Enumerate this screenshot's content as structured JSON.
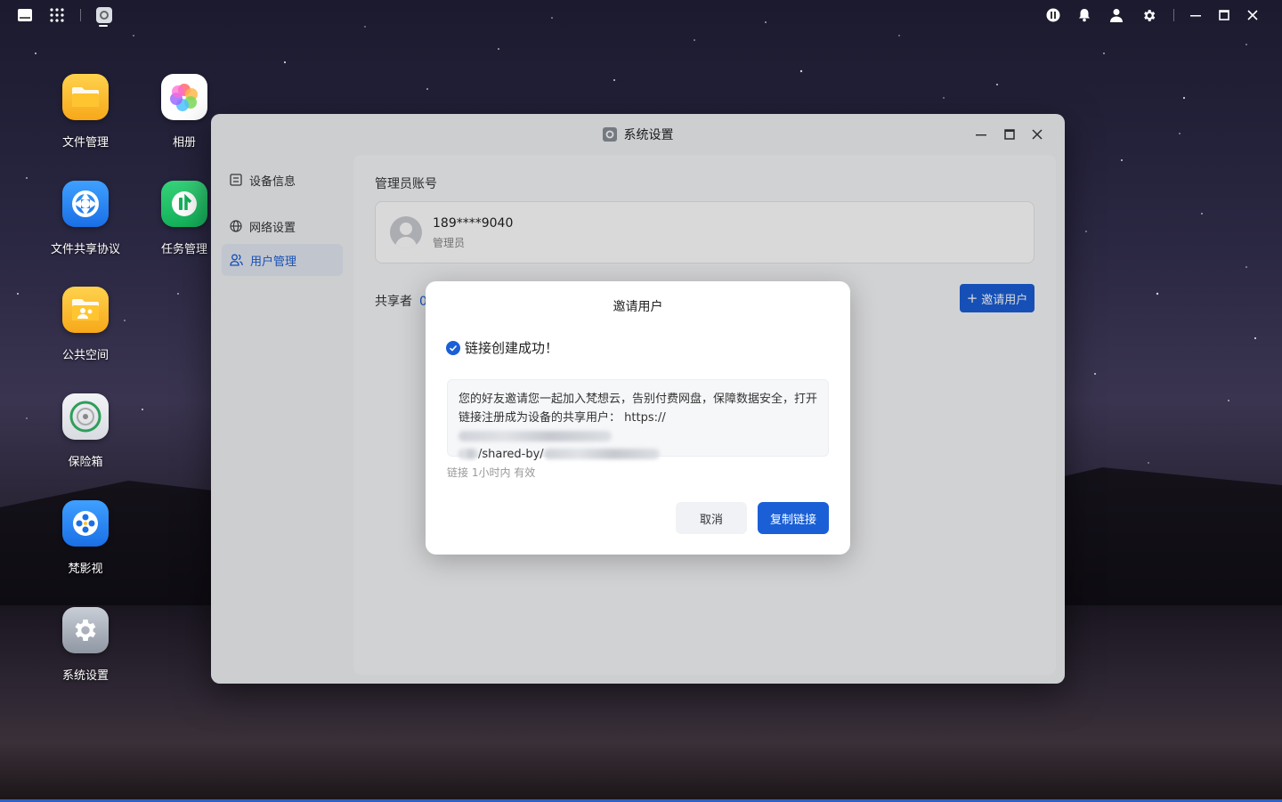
{
  "desktop": {
    "icons": [
      {
        "label": "文件管理",
        "icon": "folder-icon"
      },
      {
        "label": "相册",
        "icon": "photos-icon"
      },
      {
        "label": "文件共享协议",
        "icon": "file-share-icon"
      },
      {
        "label": "任务管理",
        "icon": "task-icon"
      },
      {
        "label": "公共空间",
        "icon": "public-space-icon"
      },
      {
        "label": "保险箱",
        "icon": "safe-icon"
      },
      {
        "label": "梵影视",
        "icon": "video-icon"
      },
      {
        "label": "系统设置",
        "icon": "settings-icon"
      }
    ]
  },
  "window": {
    "title": "系统设置"
  },
  "sidebar": {
    "items": [
      {
        "label": "设备信息",
        "icon": "device-info-icon"
      },
      {
        "label": "网络设置",
        "icon": "globe-icon"
      },
      {
        "label": "用户管理",
        "icon": "users-icon",
        "active": true
      }
    ]
  },
  "main": {
    "section_title": "管理员账号",
    "admin": {
      "name": "189****9040",
      "role": "管理员"
    },
    "sharers_label": "共享者",
    "sharers_count": "0",
    "invite_button": "邀请用户"
  },
  "modal": {
    "title": "邀请用户",
    "success_text": "链接创建成功！",
    "message_line1": "您的好友邀请您一起加入梵想云，告别付费网盘，保障数据安全，打开",
    "message_line2_prefix": "链接注册成为设备的共享用户：  https://",
    "message_line3_part": "/shared-by/",
    "validity": "链接 1小时内 有效",
    "cancel_label": "取消",
    "copy_label": "复制链接"
  },
  "colors": {
    "accent": "#1a5fd6"
  }
}
